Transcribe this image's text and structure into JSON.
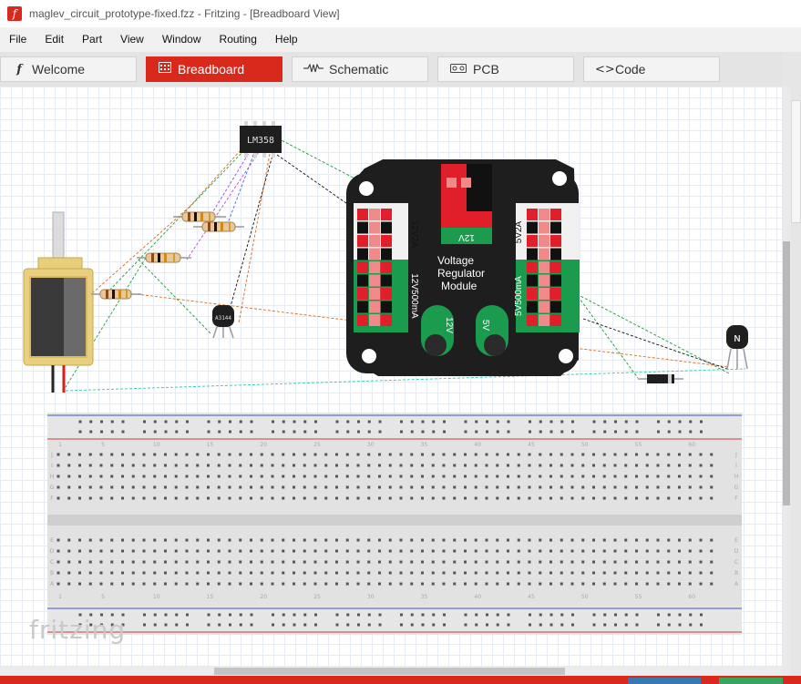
{
  "window": {
    "title": "maglev_circuit_prototype-fixed.fzz - Fritzing - [Breadboard View]",
    "app_icon": "fritzing-f-icon"
  },
  "menu": {
    "items": [
      "File",
      "Edit",
      "Part",
      "View",
      "Window",
      "Routing",
      "Help"
    ]
  },
  "tabs": [
    {
      "label": "Welcome",
      "icon": "f-logo-icon",
      "active": false
    },
    {
      "label": "Breadboard",
      "icon": "breadboard-icon",
      "active": true
    },
    {
      "label": "Schematic",
      "icon": "resistor-wave-icon",
      "active": false
    },
    {
      "label": "PCB",
      "icon": "pcb-icon",
      "active": false
    },
    {
      "label": "Code",
      "icon": "code-brackets-icon",
      "active": false
    }
  ],
  "parts": {
    "opamp_label": "LM358",
    "hall_sensor_label": "A3144",
    "transistor_label": "N",
    "vreg": {
      "label_left_top": "12V2A",
      "label_left_bottom": "12V500mA",
      "label_right_top": "5V2A",
      "label_right_bottom": "5V500mA",
      "label_top": "12V",
      "label_jack_left": "12V",
      "label_jack_right": "5V",
      "title_line1": "Voltage",
      "title_line2": "Regulator",
      "title_line3": "Module"
    },
    "breadboard_columns": [
      "1",
      "5",
      "10",
      "15",
      "20",
      "25",
      "30",
      "35",
      "40",
      "45",
      "50",
      "55",
      "60"
    ],
    "breadboard_rows_top": [
      "J",
      "I",
      "H",
      "G",
      "F"
    ],
    "breadboard_rows_bottom": [
      "E",
      "D",
      "C",
      "B",
      "A"
    ]
  },
  "watermark": "fritzing",
  "colors": {
    "accent": "#d9291c",
    "grid": "#e5ecf4",
    "vreg_body": "#1e1e1e",
    "vreg_green": "#1a9b4e",
    "pin_pink": "#f08a8a"
  }
}
